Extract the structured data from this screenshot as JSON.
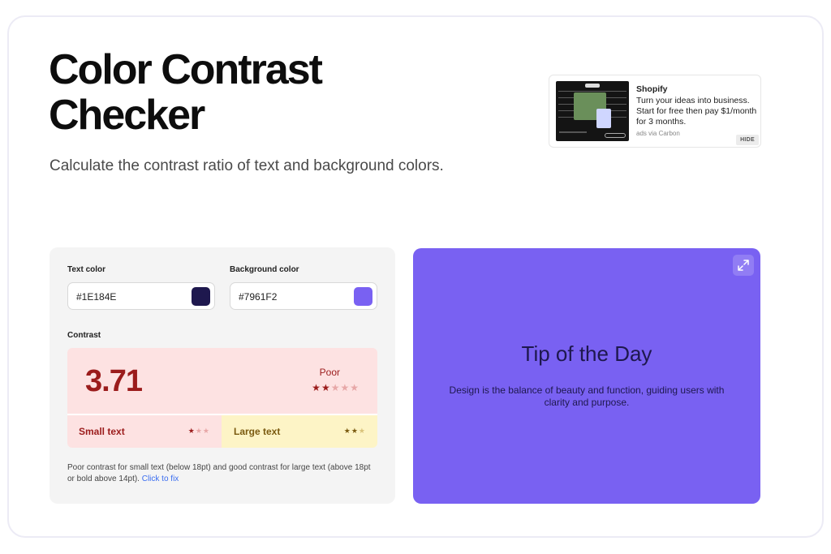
{
  "page": {
    "title": "Color Contrast Checker",
    "subtitle": "Calculate the contrast ratio of text and background colors."
  },
  "ad": {
    "brand": "Shopify",
    "text": "Turn your ideas into business. Start for free then pay $1/month for 3 months.",
    "via": "ads via Carbon",
    "hide_label": "HIDE"
  },
  "checker": {
    "text_color_label": "Text color",
    "text_color_value": "#1E184E",
    "background_color_label": "Background color",
    "background_color_value": "#7961F2",
    "contrast_label": "Contrast",
    "ratio": "3.71",
    "rating": "Poor",
    "overall_stars": 2,
    "small_text_label": "Small text",
    "small_text_stars": 1,
    "large_text_label": "Large text",
    "large_text_stars": 2,
    "stars_total": 5,
    "small_stars_total": 3,
    "note": "Poor contrast for small text (below 18pt) and good contrast for large text (above 18pt or bold above 14pt).",
    "fix_link": "Click to fix"
  },
  "preview": {
    "title": "Tip of the Day",
    "body": "Design is the balance of beauty and function, guiding users with clarity and purpose."
  },
  "colors": {
    "text": "#1E184E",
    "background": "#7961F2",
    "poor_bg": "#FDE2E2",
    "poor_fg": "#9B1C1C",
    "ok_bg": "#FDF4C6",
    "ok_fg": "#7A5A10",
    "link": "#3A6DF0"
  },
  "icons": {
    "expand": "expand-icon",
    "star": "star-icon"
  }
}
